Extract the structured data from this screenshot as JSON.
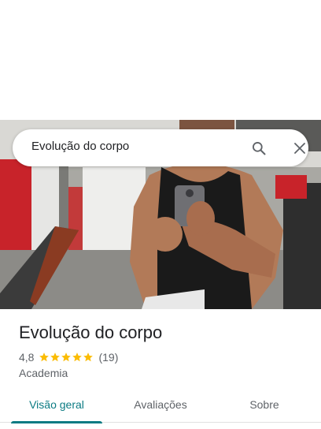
{
  "search": {
    "query": "Evolução do corpo"
  },
  "place": {
    "name": "Evolução do corpo",
    "rating": "4,8",
    "stars": 5,
    "review_count": "(19)",
    "category": "Academia"
  },
  "tabs": [
    {
      "label": "Visão geral",
      "active": true
    },
    {
      "label": "Avaliações",
      "active": false
    },
    {
      "label": "Sobre",
      "active": false
    }
  ],
  "colors": {
    "accent": "#0b7b83",
    "star": "#fbbc04",
    "text": "#202124",
    "secondary": "#5f6368"
  },
  "icons": {
    "search": "search-icon",
    "close": "close-icon",
    "star": "star-icon"
  }
}
